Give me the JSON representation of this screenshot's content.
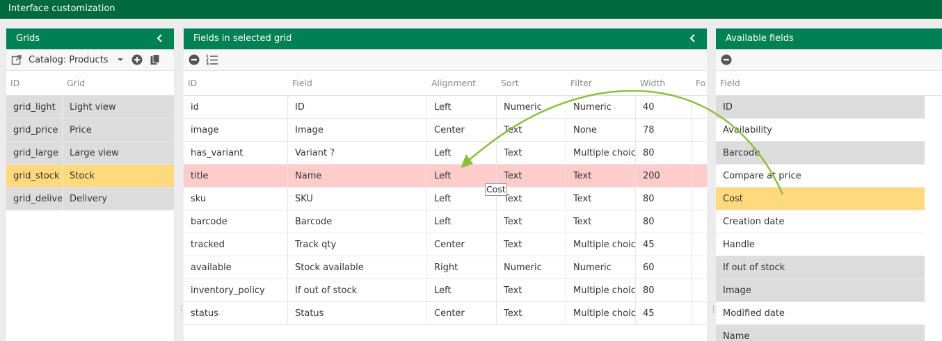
{
  "app": {
    "title": "Interface customization"
  },
  "grids_panel": {
    "title": "Grids",
    "catalog_label": "Catalog: Products",
    "columns": [
      "ID",
      "Grid"
    ],
    "rows": [
      {
        "id": "grid_light",
        "grid": "Light view"
      },
      {
        "id": "grid_price",
        "grid": "Price"
      },
      {
        "id": "grid_large",
        "grid": "Large view"
      },
      {
        "id": "grid_stock",
        "grid": "Stock"
      },
      {
        "id": "grid_deliver",
        "grid": "Delivery"
      }
    ]
  },
  "fields_panel": {
    "title": "Fields in selected grid",
    "columns": [
      "ID",
      "Field",
      "Alignment",
      "Sort",
      "Filter",
      "Width",
      "Fo"
    ],
    "rows": [
      {
        "id": "id",
        "field": "ID",
        "align": "Left",
        "sort": "Numeric",
        "filter": "Numeric",
        "width": "40"
      },
      {
        "id": "image",
        "field": "Image",
        "align": "Center",
        "sort": "Text",
        "filter": "None",
        "width": "78"
      },
      {
        "id": "has_variant",
        "field": "Variant ?",
        "align": "Left",
        "sort": "Text",
        "filter": "Multiple choice",
        "width": "80"
      },
      {
        "id": "title",
        "field": "Name",
        "align": "Left",
        "sort": "Text",
        "filter": "Text",
        "width": "200"
      },
      {
        "id": "sku",
        "field": "SKU",
        "align": "Left",
        "sort": "Text",
        "filter": "Text",
        "width": "80"
      },
      {
        "id": "barcode",
        "field": "Barcode",
        "align": "Left",
        "sort": "Text",
        "filter": "Text",
        "width": "80"
      },
      {
        "id": "tracked",
        "field": "Track qty",
        "align": "Center",
        "sort": "Text",
        "filter": "Multiple choice",
        "width": "45"
      },
      {
        "id": "available",
        "field": "Stock available",
        "align": "Right",
        "sort": "Numeric",
        "filter": "Numeric",
        "width": "60"
      },
      {
        "id": "inventory_policy",
        "field": "If out of stock",
        "align": "Left",
        "sort": "Text",
        "filter": "Multiple choice",
        "width": "80"
      },
      {
        "id": "status",
        "field": "Status",
        "align": "Center",
        "sort": "Text",
        "filter": "Multiple choice",
        "width": "45"
      }
    ]
  },
  "available_panel": {
    "title": "Available fields",
    "columns": [
      "Field"
    ],
    "rows": [
      "ID",
      "Availability",
      "Barcode",
      "Compare at price",
      "Cost",
      "Creation date",
      "Handle",
      "If out of stock",
      "Image",
      "Modified date",
      "Name"
    ]
  },
  "drag_ghost": {
    "label": "Cost"
  },
  "colors": {
    "header_bar": "#01693e",
    "panel_header": "#008055",
    "selected_row": "#ffd97d",
    "drop_target_row": "#ffcccc",
    "arrow": "#8cbf3f"
  },
  "icons": [
    "chevron-left-icon",
    "open-external-icon",
    "caret-down-icon",
    "add-circle-icon",
    "copy-icon",
    "remove-circle-icon",
    "ordered-list-icon"
  ]
}
